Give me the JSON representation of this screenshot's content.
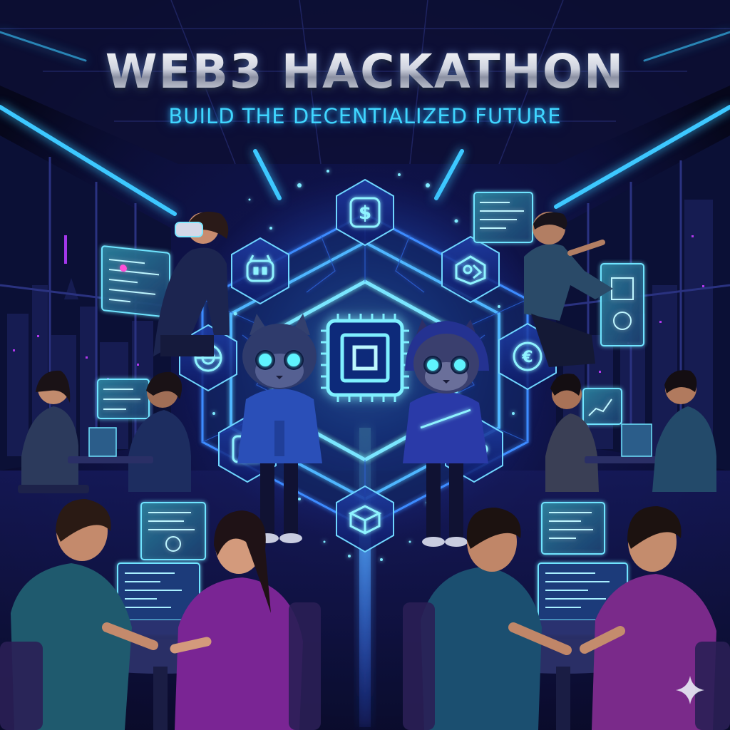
{
  "poster": {
    "title": "WEB3 HACKATHON",
    "subtitle": "BUILD THE DECENTIALIZED FUTURE"
  },
  "colors": {
    "background": "#0a0b2a",
    "neon_blue": "#2f7bff",
    "neon_cyan": "#3fd6ff",
    "purple": "#7a2aa8",
    "teal": "#1d4f63"
  },
  "icons": {
    "center_chip": "cpu-chip-icon",
    "hex_nodes": [
      "dollar-icon",
      "robot-face-icon",
      "nft-art-icon",
      "planet-token-icon",
      "euro-token-icon",
      "code-block-icon",
      "network-nodes-icon",
      "storage-block-icon"
    ],
    "watermark": "sparkle-icon"
  }
}
